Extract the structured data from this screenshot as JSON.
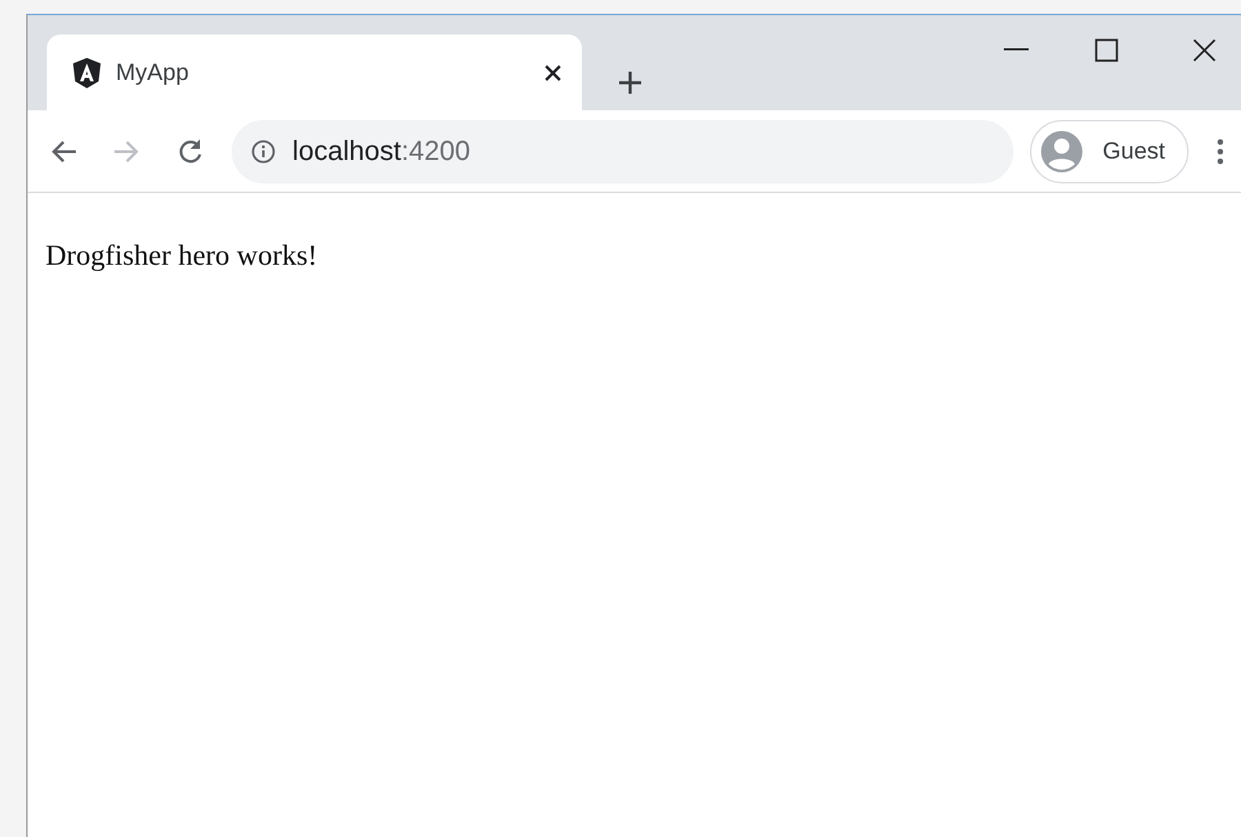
{
  "tabs": [
    {
      "title": "MyApp",
      "selected": true
    }
  ],
  "address": {
    "host": "localhost",
    "port": ":4200"
  },
  "profile": {
    "label": "Guest"
  },
  "page": {
    "text": "Drogfisher hero works!"
  }
}
